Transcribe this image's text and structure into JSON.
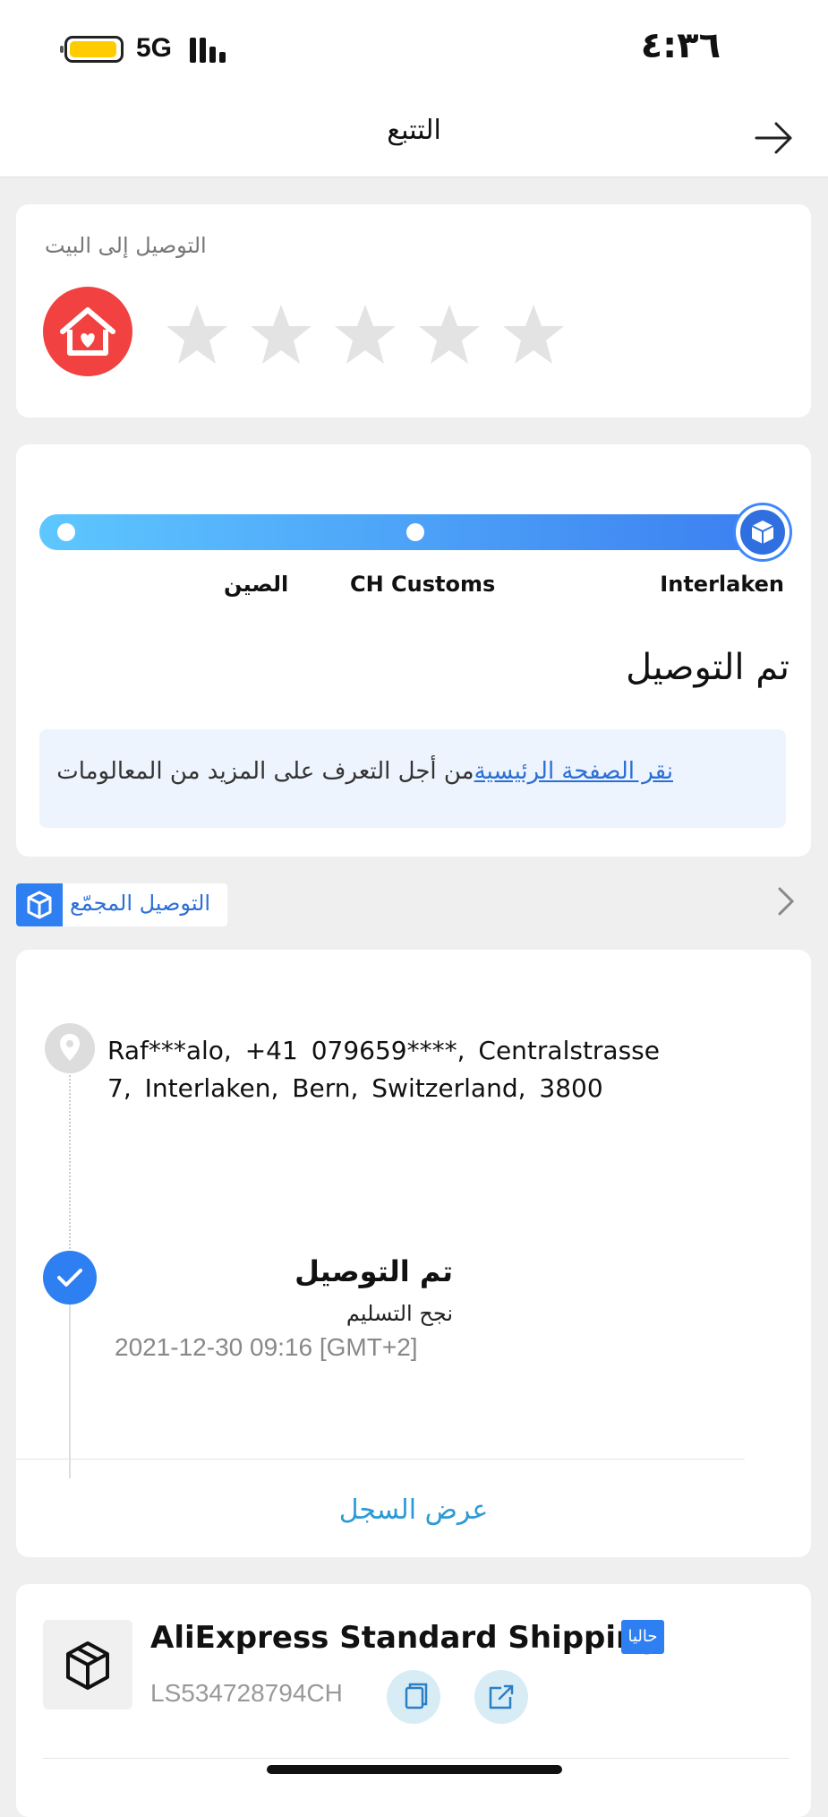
{
  "status_bar": {
    "network": "5G",
    "time": "٤:٣٦"
  },
  "header": {
    "title": "التتبع"
  },
  "delivery_rating": {
    "label": "التوصيل إلى البيت",
    "stars": 5,
    "rating": 0
  },
  "tracking_progress": {
    "stops": [
      "الصين",
      "CH Customs",
      "Interlaken"
    ],
    "status": "تم التوصيل",
    "info_link": "نقر الصفحة الرئيسية",
    "info_text": "من أجل التعرف على المزيد من المعالومات"
  },
  "combined_delivery": {
    "label": "التوصيل المجمّع"
  },
  "timeline": {
    "address": "Raf***alo, +41 079659****, Centralstrasse 7, Interlaken, Bern, Switzerland, 3800",
    "event": {
      "title": "تم التوصيل",
      "subtitle": "نجح التسليم",
      "time": "2021-12-30 09:16 [GMT+2]"
    },
    "view_history": "عرض السجل"
  },
  "shipping": {
    "carrier": "AliExpress Standard Shipping",
    "badge": "حاليا",
    "tracking_number": "LS534728794CH"
  },
  "colors": {
    "accent": "#2d7ff2",
    "house": "#f24141",
    "link": "#2b6fd6"
  }
}
